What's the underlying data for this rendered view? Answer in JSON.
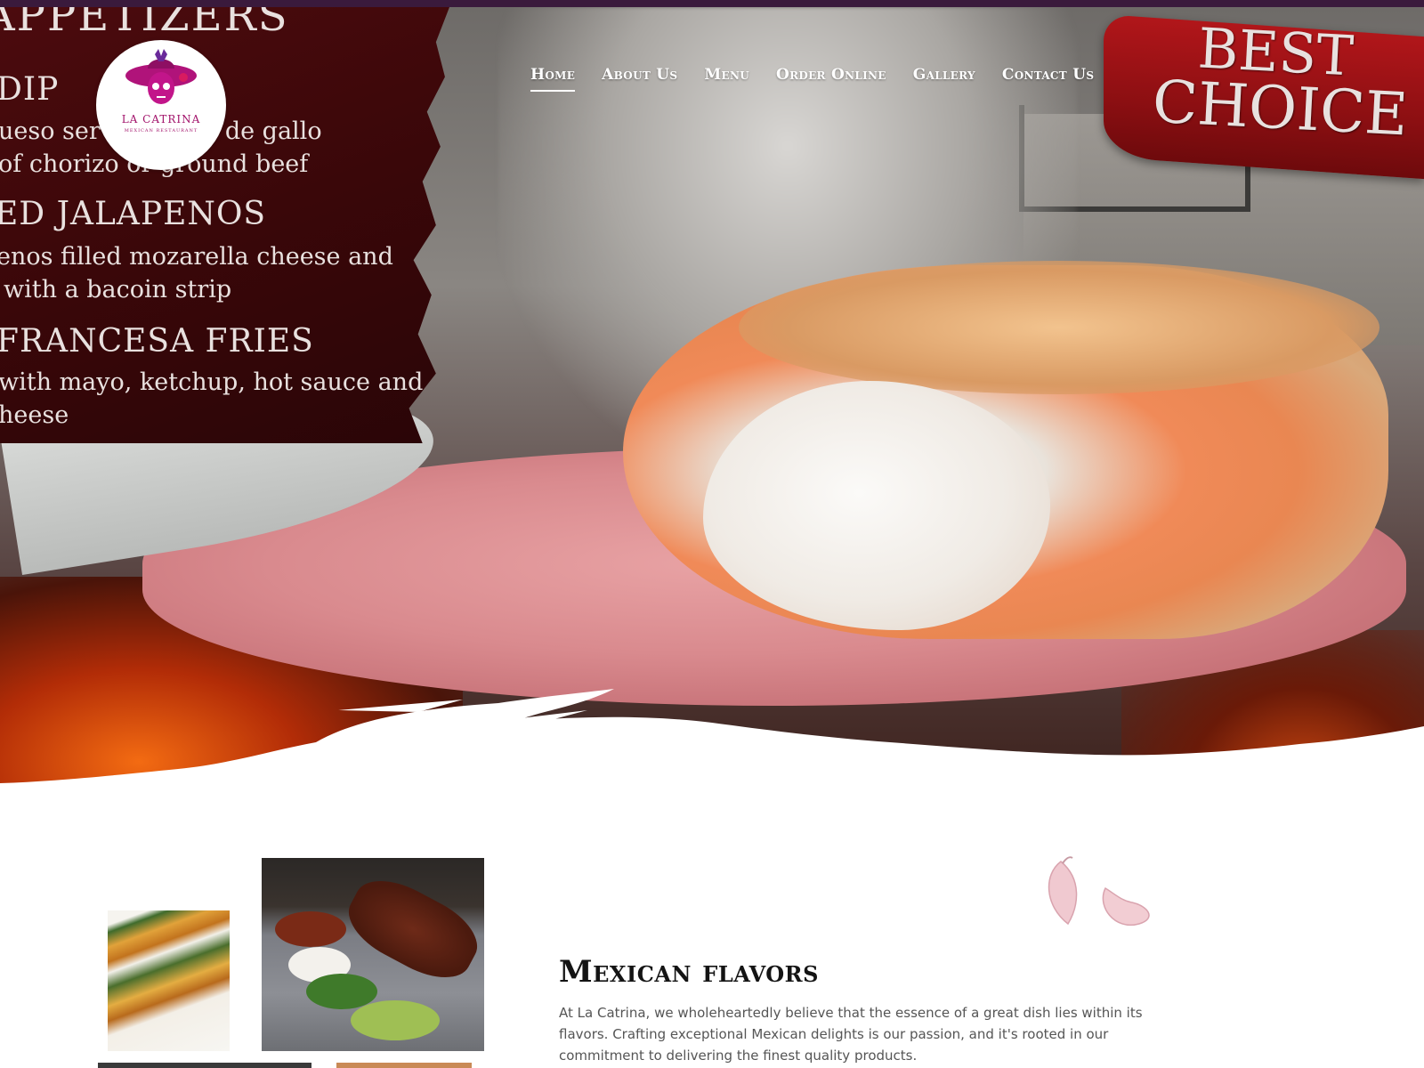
{
  "window": {
    "title": "La Catrina Mexican Restaurant"
  },
  "header": {
    "logo": {
      "name": "LA CATRINA",
      "tagline": "MEXICAN RESTAURANT"
    },
    "nav": [
      {
        "label": "Home",
        "active": true
      },
      {
        "label": "About Us",
        "active": false
      },
      {
        "label": "Menu",
        "active": false
      },
      {
        "label": "Order Online",
        "active": false
      },
      {
        "label": "Gallery",
        "active": false
      },
      {
        "label": "Contact Us",
        "active": false
      }
    ],
    "ribbon": {
      "line1": "BEST",
      "line2": "CHOICE"
    }
  },
  "hero": {
    "menu_board": {
      "heading": "APPETIZERS",
      "items": [
        {
          "name": "DIP",
          "desc": [
            "ueso served ... ico de gallo",
            "of chorizo or ground beef"
          ]
        },
        {
          "name": "ED JALAPENOS",
          "desc": [
            "enos filled mozarella cheese and",
            "with a bacoin strip"
          ]
        },
        {
          "name": "FRANCESA FRIES",
          "desc": [
            "with mayo, ketchup, hot sauce and",
            "heese"
          ]
        }
      ]
    }
  },
  "about": {
    "title": "Mexican flavors",
    "body": "At La Catrina, we wholeheartedly believe that the essence of a great dish lies within its flavors. Crafting exceptional Mexican delights is our passion, and it's rooted in our commitment to delivering the finest quality products."
  },
  "colors": {
    "topbar": "#3a1a3c",
    "menu_board": "#3a0709",
    "ribbon": "#a0141a",
    "logo_accent": "#a2126a",
    "title": "#141414",
    "body_text": "#555555"
  },
  "icons": {
    "logo": "catrina-skull-icon",
    "decor": "garlic-icon"
  }
}
